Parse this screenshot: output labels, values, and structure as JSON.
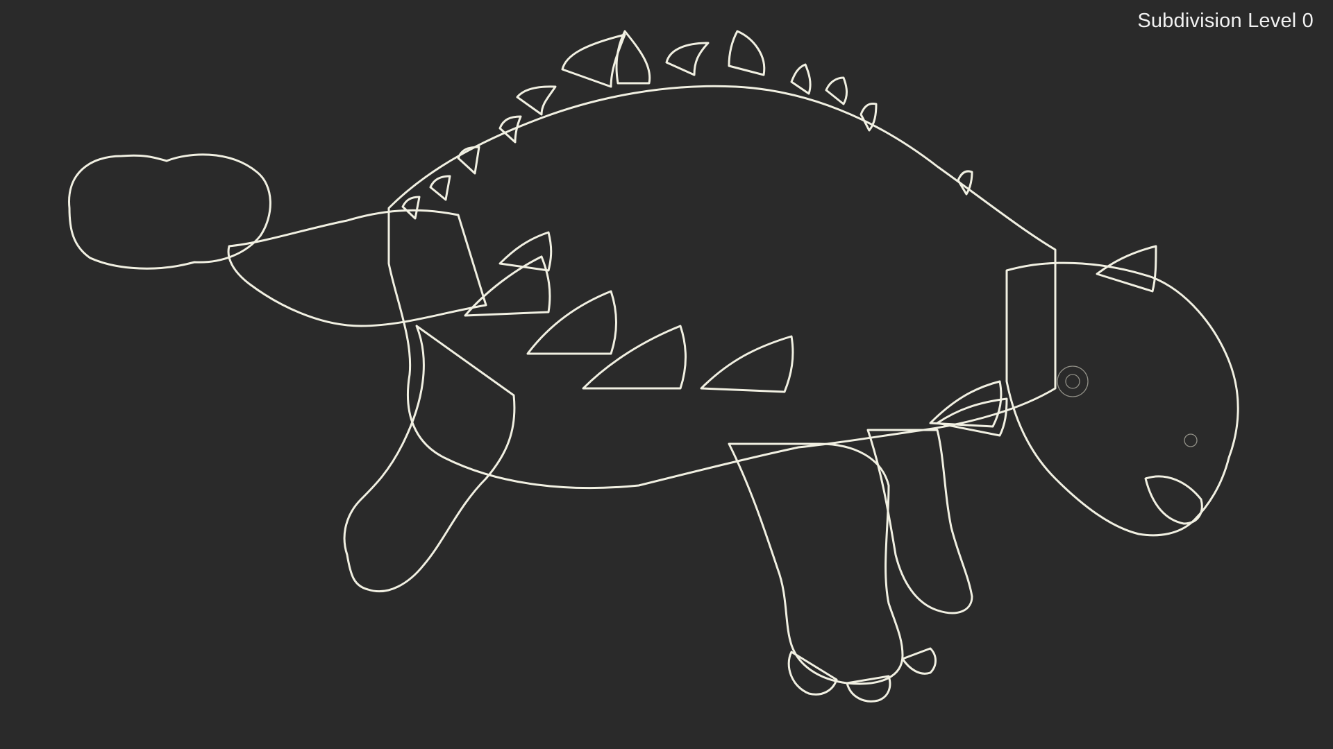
{
  "viewport": {
    "overlay_label": "Subdivision Level 0",
    "background_color": "#2a2a2a",
    "model_color": "#7d7d70",
    "wireframe_color": "#e7e6d6"
  },
  "scene": {
    "subject": "dinosaur-wireframe-model"
  }
}
